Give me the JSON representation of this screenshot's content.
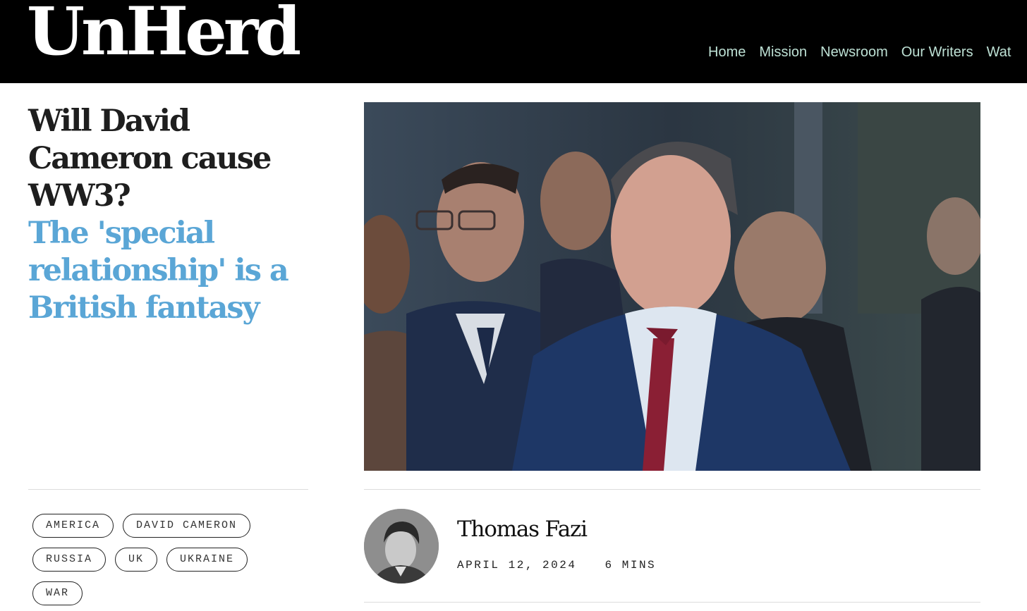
{
  "site": {
    "logo": "UnHerd"
  },
  "nav": [
    {
      "label": "Home"
    },
    {
      "label": "Mission"
    },
    {
      "label": "Newsroom"
    },
    {
      "label": "Our Writers"
    },
    {
      "label": "Wat"
    }
  ],
  "article": {
    "title": "Will David Cameron cause WW3?",
    "subtitle": "The 'special relationship' is a British fantasy",
    "tags": [
      "AMERICA",
      "DAVID CAMERON",
      "RUSSIA",
      "UK",
      "UKRAINE",
      "WAR"
    ],
    "author": "Thomas Fazi",
    "date": "APRIL 12, 2024",
    "read_time": "6 MINS"
  },
  "colors": {
    "header_bg": "#000000",
    "nav_text": "#bde0d4",
    "subtitle": "#5aa6d6"
  }
}
